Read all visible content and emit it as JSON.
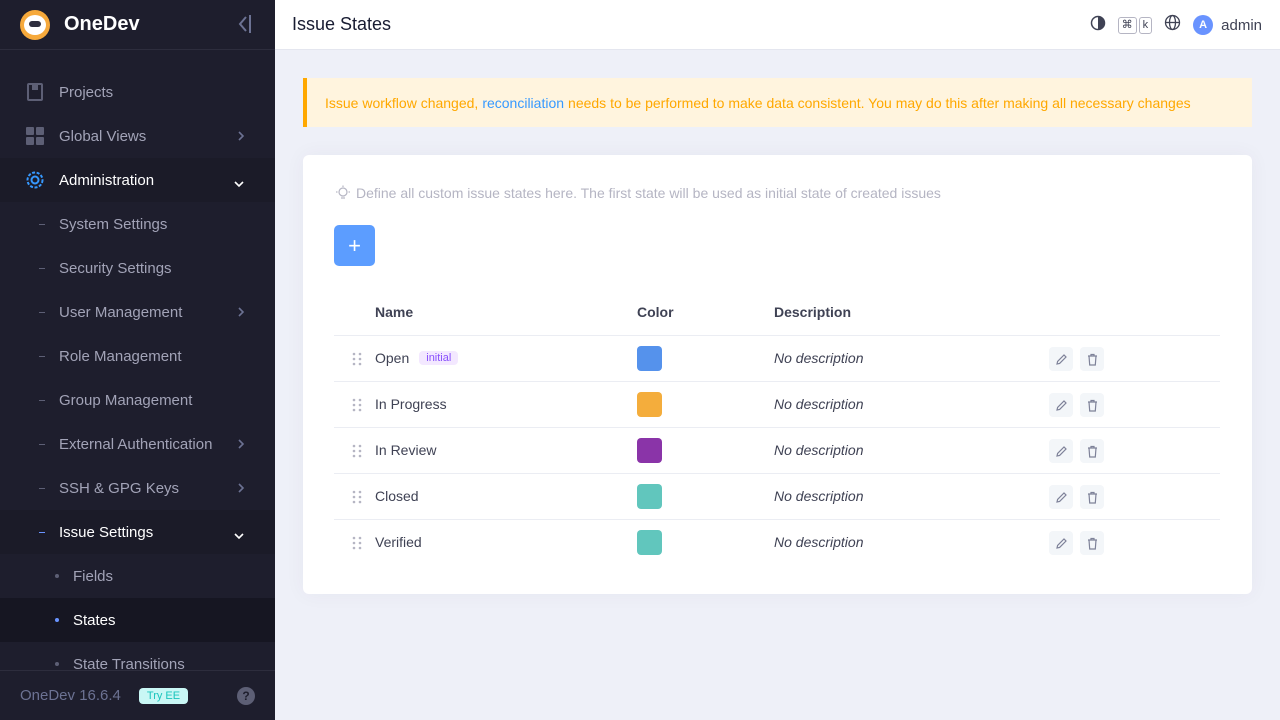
{
  "app": {
    "name": "OneDev",
    "version": "OneDev 16.6.4",
    "try_ee": "Try EE"
  },
  "sidebar": {
    "projects": "Projects",
    "global_views": "Global Views",
    "administration": "Administration",
    "admin_items": {
      "system_settings": "System Settings",
      "security_settings": "Security Settings",
      "user_management": "User Management",
      "role_management": "Role Management",
      "group_management": "Group Management",
      "external_authentication": "External Authentication",
      "ssh_gpg_keys": "SSH & GPG Keys",
      "issue_settings": "Issue Settings"
    },
    "issue_items": {
      "fields": "Fields",
      "states": "States",
      "state_transitions": "State Transitions"
    }
  },
  "header": {
    "title": "Issue States",
    "kbd1": "⌘",
    "kbd2": "k",
    "avatar_letter": "A",
    "user": "admin"
  },
  "alert": {
    "before": "Issue workflow changed,",
    "link": "reconciliation",
    "after": "needs to be performed to make data consistent. You may do this after making all necessary changes"
  },
  "card": {
    "hint": "Define all custom issue states here. The first state will be used as initial state of created issues",
    "add": "+",
    "columns": {
      "name": "Name",
      "color": "Color",
      "description": "Description"
    },
    "initial_badge": "initial",
    "states": [
      {
        "name": "Open",
        "color": "#5592ec",
        "description": "No description"
      },
      {
        "name": "In Progress",
        "color": "#f4ad3c",
        "description": "No description"
      },
      {
        "name": "In Review",
        "color": "#8a34a8",
        "description": "No description"
      },
      {
        "name": "Closed",
        "color": "#61c6bd",
        "description": "No description"
      },
      {
        "name": "Verified",
        "color": "#61c6bd",
        "description": "No description"
      }
    ]
  }
}
